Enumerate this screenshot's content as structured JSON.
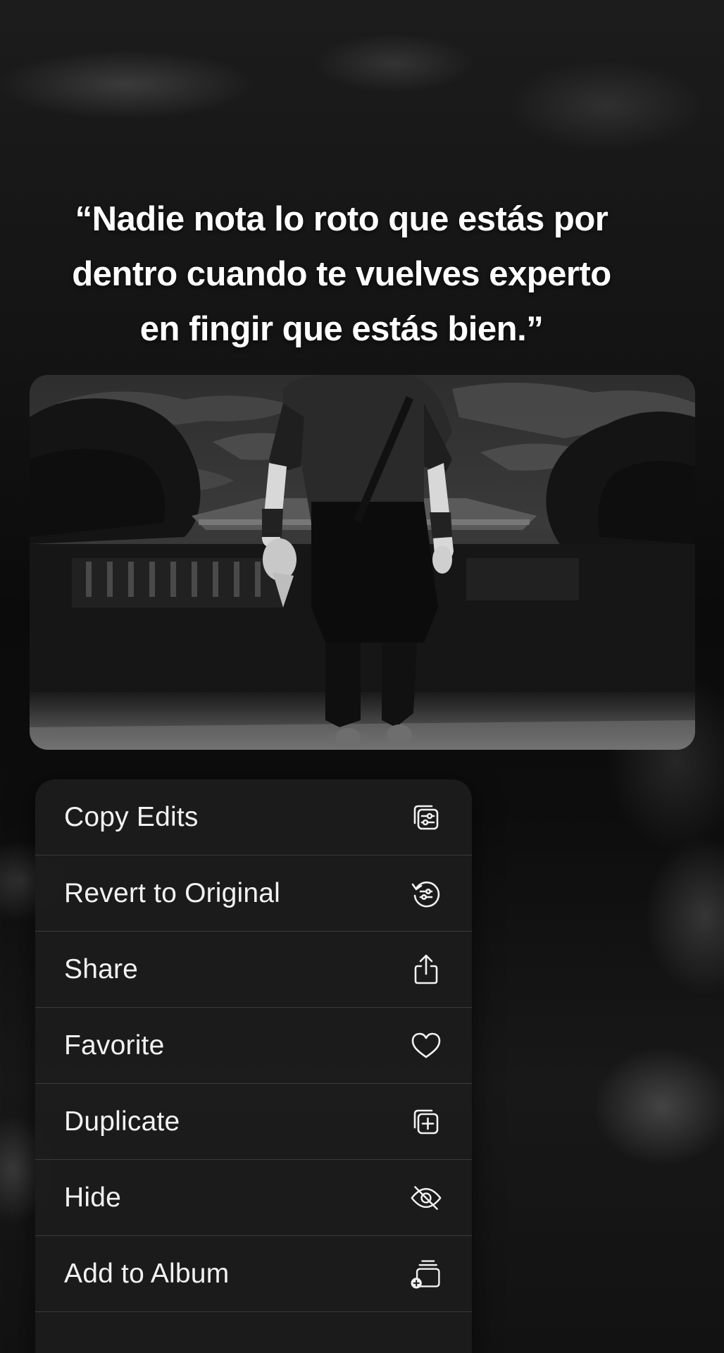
{
  "quote": {
    "line1": "“Nadie nota lo roto que estás por",
    "line2": "dentro cuando te vuelves experto",
    "line3": "en fingir que estás bien.”"
  },
  "menu": {
    "items": [
      {
        "label": "Copy Edits",
        "icon": "copy-edits-icon"
      },
      {
        "label": "Revert to Original",
        "icon": "revert-icon"
      },
      {
        "label": "Share",
        "icon": "share-icon"
      },
      {
        "label": "Favorite",
        "icon": "heart-icon"
      },
      {
        "label": "Duplicate",
        "icon": "duplicate-icon"
      },
      {
        "label": "Hide",
        "icon": "eye-slash-icon"
      },
      {
        "label": "Add to Album",
        "icon": "add-to-album-icon"
      }
    ]
  },
  "colors": {
    "menu_background": "#1c1c1c",
    "menu_text": "#f2f2f2",
    "separator": "#3a3a3a",
    "quote_text": "#ffffff"
  }
}
